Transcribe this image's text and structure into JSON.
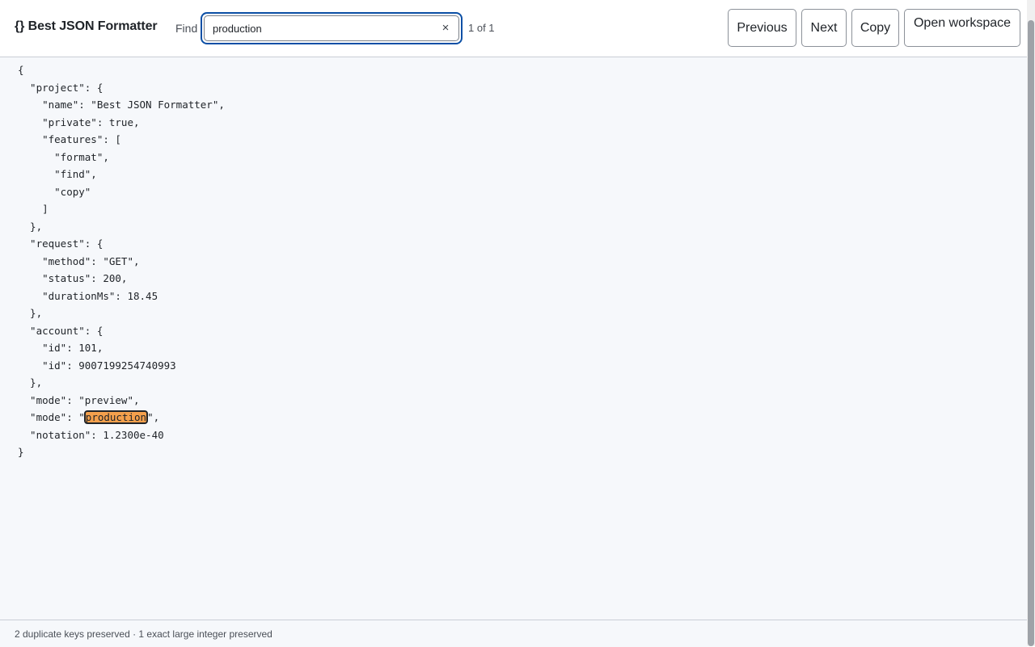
{
  "app": {
    "brand_icon": "{}",
    "title": "Best JSON Formatter"
  },
  "find": {
    "label": "Find",
    "value": "production",
    "placeholder": "",
    "clear_icon": "×",
    "match_count": "1 of 1"
  },
  "toolbar": {
    "previous_label": "Previous",
    "next_label": "Next",
    "copy_label": "Copy",
    "open_workspace_label": "Open workspace"
  },
  "code": {
    "lines": [
      "{",
      "  \"project\": {",
      "    \"name\": \"Best JSON Formatter\",",
      "    \"private\": true,",
      "    \"features\": [",
      "      \"format\",",
      "      \"find\",",
      "      \"copy\"",
      "    ]",
      "  },",
      "  \"request\": {",
      "    \"method\": \"GET\",",
      "    \"status\": 200,",
      "    \"durationMs\": 18.45",
      "  },",
      "  \"account\": {",
      "    \"id\": 101,",
      "    \"id\": 9007199254740993",
      "  },",
      "  \"mode\": \"preview\",",
      {
        "before": "  \"mode\": \"",
        "match": "production",
        "after": "\","
      },
      "  \"notation\": 1.2300e-40",
      "}"
    ]
  },
  "status": {
    "text": "2 duplicate keys preserved · 1 exact large integer preserved"
  },
  "colors": {
    "focus_ring": "#0b4fa5",
    "match_highlight": "#f4a04c",
    "editor_background": "#f6f8fb"
  }
}
